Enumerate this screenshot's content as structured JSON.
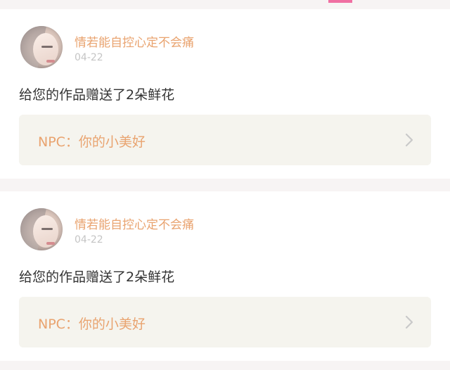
{
  "colors": {
    "accent_orange": "#e9a36f",
    "tab_pink": "#f06fa2",
    "card_bg": "#ffffff",
    "page_bg": "#f7f4f4",
    "link_bg": "#f5f4ee"
  },
  "feed": [
    {
      "username": "情若能自控心定不会痛",
      "date": "04-22",
      "message": "给您的作品赠送了2朵鲜花",
      "work_title": "NPC：你的小美好",
      "chevron_icon": "chevron-right-icon"
    },
    {
      "username": "情若能自控心定不会痛",
      "date": "04-22",
      "message": "给您的作品赠送了2朵鲜花",
      "work_title": "NPC：你的小美好",
      "chevron_icon": "chevron-right-icon"
    }
  ]
}
